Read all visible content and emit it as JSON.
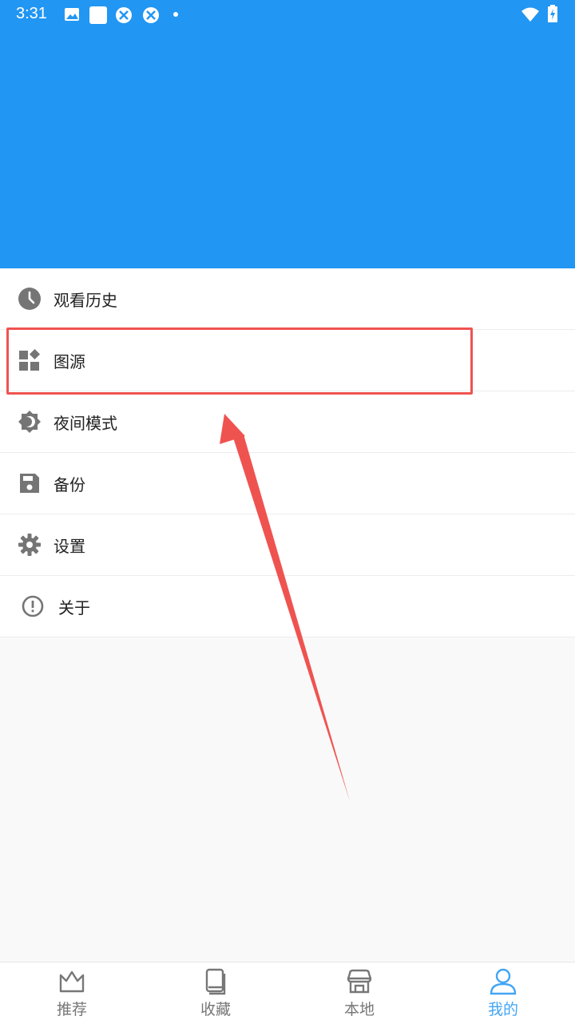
{
  "status_bar": {
    "time": "3:31"
  },
  "menu": {
    "items": [
      {
        "label": "观看历史",
        "icon": "clock-icon"
      },
      {
        "label": "图源",
        "icon": "widgets-icon"
      },
      {
        "label": "夜间模式",
        "icon": "night-mode-icon"
      },
      {
        "label": "备份",
        "icon": "save-icon"
      },
      {
        "label": "设置",
        "icon": "gear-icon"
      },
      {
        "label": "关于",
        "icon": "info-alert-icon"
      }
    ]
  },
  "bottom_nav": {
    "items": [
      {
        "label": "推荐",
        "icon": "crown-icon"
      },
      {
        "label": "收藏",
        "icon": "book-icon"
      },
      {
        "label": "本地",
        "icon": "store-icon"
      },
      {
        "label": "我的",
        "icon": "person-icon"
      }
    ],
    "active_label": "我的"
  },
  "colors": {
    "primary": "#2196f3",
    "accent": "#42a5f5",
    "annotation": "#ef5350",
    "icon": "#757575"
  }
}
